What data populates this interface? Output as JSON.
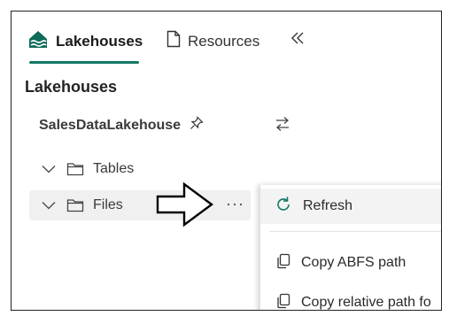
{
  "tabs": [
    {
      "label": "Lakehouses",
      "icon": "lakehouse-icon",
      "active": true
    },
    {
      "label": "Resources",
      "icon": "document-icon",
      "active": false
    }
  ],
  "collapse_icon": "double-chevron-left-icon",
  "panel": {
    "heading": "Lakehouses",
    "lakehouse_name": "SalesDataLakehouse",
    "pin_icon": "pin-icon",
    "swap_icon": "swap-arrows-icon"
  },
  "tree": [
    {
      "label": "Tables",
      "icon": "folder-icon",
      "expanded": false
    },
    {
      "label": "Files",
      "icon": "folder-icon",
      "expanded": false,
      "more": "···"
    }
  ],
  "context_menu": {
    "items": [
      {
        "label": "Refresh",
        "icon": "refresh-icon"
      },
      {
        "label": "Copy ABFS path",
        "icon": "copy-icon"
      },
      {
        "label": "Copy relative path fo",
        "icon": "copy-icon"
      }
    ]
  },
  "colors": {
    "accent": "#117865",
    "menu_refresh_icon": "#117865"
  }
}
